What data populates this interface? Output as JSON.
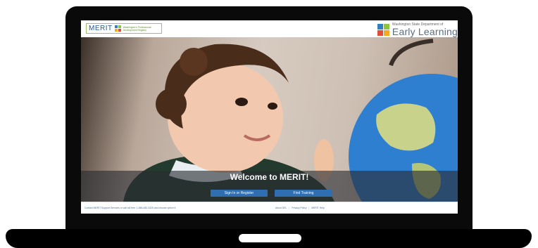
{
  "header": {
    "merit_logo": {
      "word": "MERIT",
      "subtitle_line1": "Washington's Professional",
      "subtitle_line2": "Development Registry",
      "block_colors": [
        "#2f7fc1",
        "#8cc63f",
        "#f7a823",
        "#e04e39"
      ]
    },
    "agency_logo": {
      "line1": "Washington State Department of",
      "line2": "Early Learning",
      "block_colors": [
        "#2f7fc1",
        "#8cc63f",
        "#e04e39",
        "#f7a823"
      ]
    }
  },
  "hero": {
    "title": "Welcome to MERIT!",
    "buttons": {
      "sign_in": "Sign In or Register",
      "find_training": "Find Training"
    }
  },
  "footer": {
    "contact": "Contact MERIT Support Services or call toll free: 1-866-482-4325 and choose option 5",
    "links": [
      "About DEL",
      "Privacy Policy",
      "MERIT Help"
    ],
    "separator": "|"
  },
  "colors": {
    "button": "#2f6fb1",
    "overlay": "#2c3036",
    "link": "#4a6f99"
  }
}
